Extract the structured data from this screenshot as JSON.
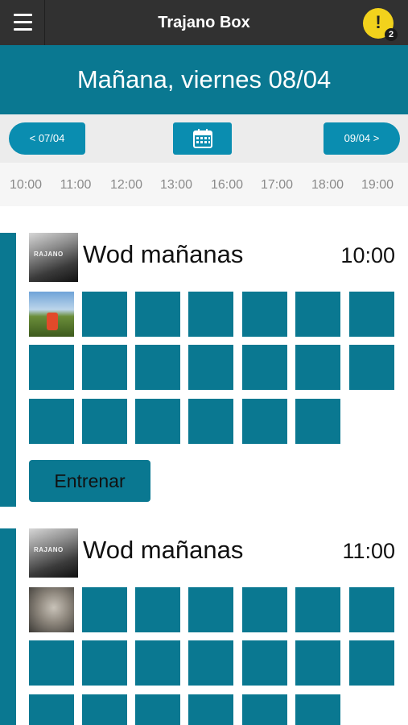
{
  "app": {
    "title": "Trajano Box",
    "alert_count": "2",
    "alert_symbol": "!"
  },
  "day": {
    "title": "Mañana, viernes 08/04"
  },
  "nav": {
    "prev_label": "< 07/04",
    "next_label": "09/04 >",
    "calendar_icon": "calendar-icon"
  },
  "hours": [
    "10:00",
    "11:00",
    "12:00",
    "13:00",
    "16:00",
    "17:00",
    "18:00",
    "19:00"
  ],
  "classes": [
    {
      "name": "Wod mañanas",
      "time": "10:00",
      "coach_logo_text": "RAJANO",
      "button_label": "Entrenar"
    },
    {
      "name": "Wod mañanas",
      "time": "11:00",
      "coach_logo_text": "RAJANO"
    }
  ],
  "colors": {
    "header": "#313131",
    "primary": "#0a7891",
    "nav_button": "#0a8db0",
    "alert": "#f2d21c"
  }
}
